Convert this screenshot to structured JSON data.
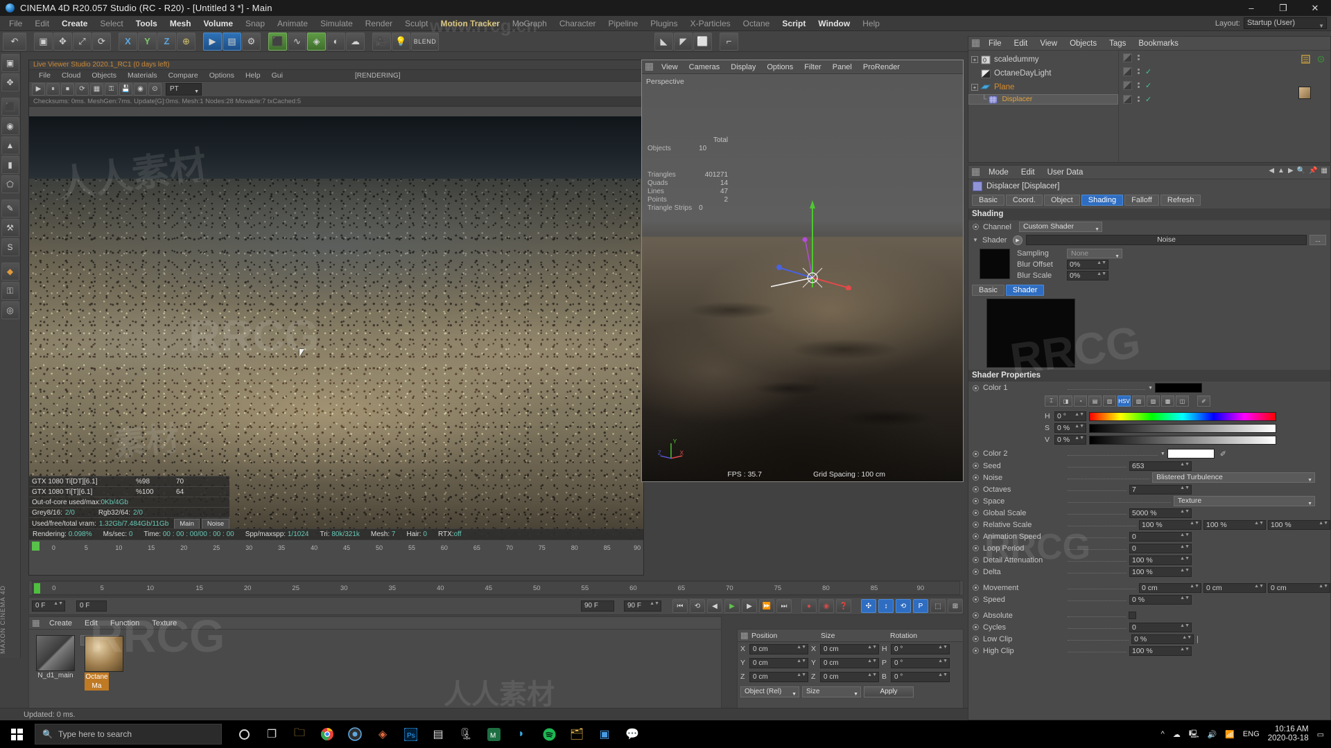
{
  "window": {
    "title": "CINEMA 4D R20.057 Studio (RC - R20) - [Untitled 3 *] - Main",
    "minimize": "–",
    "maximize": "❐",
    "close": "✕"
  },
  "menubar": {
    "items": [
      "File",
      "Edit",
      "Create",
      "Select",
      "Tools",
      "Mesh",
      "Volume",
      "Snap",
      "Animate",
      "Simulate",
      "Render",
      "Sculpt",
      "Motion Tracker",
      "MoGraph",
      "Character",
      "Pipeline",
      "Plugins",
      "X-Particles",
      "Octane",
      "Script",
      "Window",
      "Help"
    ],
    "layout_label": "Layout:",
    "layout_value": "Startup (User)"
  },
  "toolbar": {
    "undo": "↶",
    "buttons": [
      "⯅",
      "✥",
      "⟳",
      "⤢",
      "X",
      "Y",
      "Z",
      "↻",
      "⧉",
      "◳",
      "▦",
      "◈",
      "▲",
      "✦",
      "⬟",
      "◉",
      "⚒",
      "⚙",
      "★"
    ],
    "axis_x": "X",
    "axis_y": "Y",
    "axis_z": "Z",
    "render_label": "BLEND"
  },
  "left_toolbar": {
    "items": [
      "⬚",
      "▣",
      "◉",
      "△",
      "⬟",
      "⬡",
      "▱",
      "⚒",
      "S",
      "✎",
      "◆",
      "⚿",
      "◎"
    ],
    "vertical_label": "MAXON CINEMA 4D"
  },
  "live_viewer": {
    "title": "Live Viewer Studio 2020.1_RC1 (0 days left)",
    "menu": [
      "File",
      "Cloud",
      "Objects",
      "Materials",
      "Compare",
      "Options",
      "Help",
      "Gui"
    ],
    "rendering_label": "[RENDERING]",
    "preset": "PT",
    "status_line": "Checksums: 0ms. MeshGen:7ms. Update[G]:0ms. Mesh:1 Nodes:28 Movable:7 txCached:5",
    "gpu_stats": [
      {
        "name": "GTX 1080 Ti[DT][6.1]",
        "pct": "%98",
        "val": "70"
      },
      {
        "name": "GTX 1080 Ti[T][6.1]",
        "pct": "%100",
        "val": "64"
      }
    ],
    "out_of_core_label": "Out-of-core used/max:",
    "out_of_core_value": "0Kb/4Gb",
    "grey_label": "Grey8/16:",
    "grey_value": "2/0",
    "rgb_label": "Rgb32/64:",
    "rgb_value": "2/0",
    "vram_label": "Used/free/total vram:",
    "vram_value": "1.32Gb/7.484Gb/11Gb",
    "tabs": [
      "Main",
      "Noise"
    ],
    "render_status": [
      {
        "label": "Rendering:",
        "value": "0.098%"
      },
      {
        "label": "Ms/sec:",
        "value": "0"
      },
      {
        "label": "Time:",
        "value": "00 : 00 : 00/00 : 00 : 00"
      },
      {
        "label": "Spp/maxspp:",
        "value": "1/1024"
      },
      {
        "label": "Tri:",
        "value": "80k/321k"
      },
      {
        "label": "Mesh:",
        "value": "7"
      },
      {
        "label": "Hair:",
        "value": "0"
      },
      {
        "label": "RTX:",
        "value": "off"
      }
    ],
    "timeline_ticks": [
      "0",
      "5",
      "10",
      "15",
      "20",
      "25",
      "30",
      "35",
      "40",
      "45",
      "50",
      "55",
      "60",
      "65",
      "70",
      "75",
      "80",
      "85",
      "90"
    ]
  },
  "viewport": {
    "menu": [
      "View",
      "Cameras",
      "Display",
      "Options",
      "Filter",
      "Panel",
      "ProRender"
    ],
    "camera": "Perspective",
    "stats_header": "Total",
    "stats": [
      {
        "label": "Objects",
        "value": "10"
      },
      {
        "label": "Triangles",
        "value": "401271"
      },
      {
        "label": "Quads",
        "value": "14"
      },
      {
        "label": "Lines",
        "value": "47"
      },
      {
        "label": "Points",
        "value": "2"
      },
      {
        "label": "Triangle Strips",
        "value": "0"
      }
    ],
    "fps": "FPS : 35.7",
    "grid_spacing": "Grid Spacing : 100 cm",
    "axis_x": "X",
    "axis_y": "Y",
    "axis_z": "Z"
  },
  "object_manager": {
    "menu": [
      "File",
      "Edit",
      "View",
      "Objects",
      "Tags",
      "Bookmarks"
    ],
    "items": [
      {
        "name": "scaledummy",
        "icon": "null-icon",
        "selected": false,
        "expandable": true,
        "check": false
      },
      {
        "name": "OctaneDayLight",
        "icon": "light-icon",
        "selected": false,
        "expandable": false,
        "check": true
      },
      {
        "name": "Plane",
        "icon": "plane-icon",
        "selected": true,
        "expandable": true,
        "check": true
      },
      {
        "name": "Displacer",
        "icon": "displacer-icon",
        "selected": true,
        "expandable": false,
        "check": true
      }
    ]
  },
  "attribute_manager": {
    "menu": [
      "Mode",
      "Edit",
      "User Data"
    ],
    "object_title": "Displacer [Displacer]",
    "tabs": [
      "Basic",
      "Coord.",
      "Object",
      "Shading",
      "Falloff",
      "Refresh"
    ],
    "active_tab": "Shading",
    "shading_group": "Shading",
    "channel_label": "Channel",
    "channel_value": "Custom Shader",
    "shader_label": "Shader",
    "shader_value": "Noise",
    "sampling_label": "Sampling",
    "sampling_value": "None",
    "blur_offset_label": "Blur Offset",
    "blur_offset_value": "0%",
    "blur_scale_label": "Blur Scale",
    "blur_scale_value": "0%",
    "inner_tabs": [
      "Basic",
      "Shader"
    ],
    "inner_active_tab": "Shader",
    "shader_properties_group": "Shader Properties",
    "color1_label": "Color 1",
    "color1_value": "#000000",
    "hsv_label": "HSV",
    "h_label": "H",
    "h_value": "0 °",
    "s_label": "S",
    "s_value": "0 %",
    "v_label": "V",
    "v_value": "0 %",
    "color2_label": "Color 2",
    "color2_value": "#ffffff",
    "properties": [
      {
        "label": "Seed",
        "value": "653",
        "type": "number"
      },
      {
        "label": "Noise",
        "value": "Blistered Turbulence",
        "type": "select"
      },
      {
        "label": "Octaves",
        "value": "7",
        "type": "number"
      },
      {
        "label": "Space",
        "value": "Texture",
        "type": "select"
      },
      {
        "label": "Global Scale",
        "value": "5000 %",
        "type": "number"
      },
      {
        "label": "Relative Scale",
        "value": "100 %",
        "value2": "100 %",
        "value3": "100 %",
        "type": "number3"
      },
      {
        "label": "Animation Speed",
        "value": "0",
        "type": "number"
      },
      {
        "label": "Loop Period",
        "value": "0",
        "type": "number"
      },
      {
        "label": "Detail Attenuation",
        "value": "100 %",
        "type": "number"
      },
      {
        "label": "Delta",
        "value": "100 %",
        "type": "number"
      },
      {
        "label": "Movement",
        "value": "0 cm",
        "value2": "0 cm",
        "value3": "0 cm",
        "type": "number3"
      },
      {
        "label": "Speed",
        "value": "0 %",
        "type": "number"
      },
      {
        "label": "Absolute",
        "value": "",
        "type": "checkbox"
      },
      {
        "label": "Cycles",
        "value": "0",
        "type": "number"
      },
      {
        "label": "Low Clip",
        "value": "0 %",
        "type": "number"
      },
      {
        "label": "High Clip",
        "value": "100 %",
        "type": "number"
      }
    ]
  },
  "animation_bar": {
    "current_frame": "0 F",
    "start_frame": "0 F",
    "end_label_left": "90 F",
    "end_frame": "90 F",
    "buttons": [
      "⏮",
      "⏪",
      "◀",
      "▶",
      "▶",
      "⏩",
      "⏭",
      "●",
      "◉",
      "❓"
    ],
    "toggles": [
      "✣",
      "↕",
      "⟲",
      "P",
      "⬚",
      "⊞"
    ]
  },
  "material_manager": {
    "menu": [
      "Create",
      "Edit",
      "Function",
      "Texture"
    ],
    "materials": [
      {
        "name": "N_d1_main",
        "selected": false
      },
      {
        "name": "Octane Ma",
        "selected": true
      }
    ]
  },
  "coordinate_manager": {
    "headers": [
      "Position",
      "Size",
      "Rotation"
    ],
    "rows": [
      {
        "axis": "X",
        "position": "0 cm",
        "size_axis": "X",
        "size": "0 cm",
        "rot_axis": "H",
        "rotation": "0 °"
      },
      {
        "axis": "Y",
        "position": "0 cm",
        "size_axis": "Y",
        "size": "0 cm",
        "rot_axis": "P",
        "rotation": "0 °"
      },
      {
        "axis": "Z",
        "position": "0 cm",
        "size_axis": "Z",
        "size": "0 cm",
        "rot_axis": "B",
        "rotation": "0 °"
      }
    ],
    "mode": "Object (Rel)",
    "size_mode": "Size",
    "apply": "Apply"
  },
  "statusbar": {
    "text": "Updated: 0 ms."
  },
  "taskbar": {
    "search_placeholder": "Type here to search",
    "lang": "ENG",
    "time": "10:16 AM",
    "date": "2020-03-18"
  },
  "colors": {
    "accent_blue": "#2e6dc1",
    "orange_selected": "#e4a33c",
    "green_stat": "#67c7b5",
    "title_orange": "#cd8a36"
  },
  "watermarks": [
    "www.rrcg.cn",
    "RRCG",
    "人人素材",
    "素材"
  ]
}
